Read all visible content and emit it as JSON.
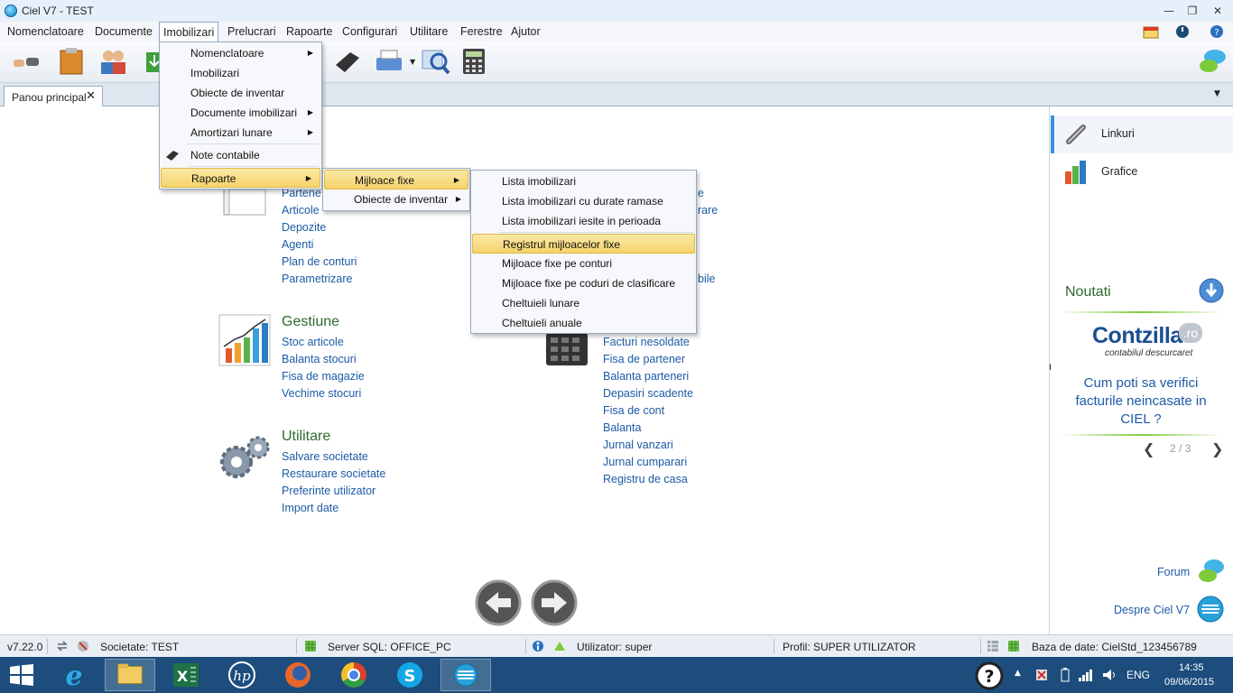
{
  "window": {
    "title": "Ciel V7 - TEST",
    "min": "—",
    "restore": "❐",
    "close": "✕"
  },
  "menubar": [
    "Nomenclatoare",
    "Documente",
    "Imobilizari",
    "Prelucrari",
    "Rapoarte",
    "Configurari",
    "Utilitare",
    "Ferestre",
    "Ajutor"
  ],
  "tab": {
    "label": "Panou principal",
    "close": "✕"
  },
  "main": {
    "col1": {
      "partial_links": [
        "Partene",
        "Articole",
        "Depozite",
        "Agenti",
        "Plan de conturi",
        "Parametrizare"
      ]
    },
    "gestiune": {
      "title": "Gestiune",
      "links": [
        "Stoc articole",
        "Balanta stocuri",
        "Fisa de magazie",
        "Vechime stocuri"
      ]
    },
    "utilitare": {
      "title": "Utilitare",
      "links": [
        "Salvare societate",
        "Restaurare societate",
        "Preferinte utilizator",
        "Import date"
      ]
    },
    "col2": {
      "partial_top": [
        "e",
        "rare"
      ],
      "partial_mid": "bile",
      "links": [
        "Facturi nesoldate",
        "Fisa de partener",
        "Balanta parteneri",
        "Depasiri scadente",
        "Fisa de cont",
        "Balanta",
        "Jurnal vanzari",
        "Jurnal cumparari",
        "Registru de casa"
      ]
    }
  },
  "menu_imobilizari": [
    {
      "label": "Nomenclatoare",
      "arrow": "▶"
    },
    {
      "label": "Imobilizari",
      "arrow": ""
    },
    {
      "label": "Obiecte de inventar",
      "arrow": ""
    },
    {
      "label": "Documente imobilizari",
      "arrow": "▶"
    },
    {
      "label": "Amortizari lunare",
      "arrow": "▶"
    },
    {
      "label": "Note contabile",
      "arrow": ""
    },
    {
      "label": "Rapoarte",
      "arrow": "▶"
    }
  ],
  "menu_rapoarte": [
    {
      "label": "Mijloace fixe",
      "arrow": "▶"
    },
    {
      "label": "Obiecte de inventar",
      "arrow": "▶"
    }
  ],
  "menu_mijloace": [
    "Lista imobilizari",
    "Lista imobilizari cu durate ramase",
    "Lista imobilizari iesite in perioada",
    "Registrul mijloacelor fixe",
    "Mijloace fixe pe conturi",
    "Mijloace fixe pe coduri de clasificare",
    "Cheltuieli lunare",
    "Cheltuieli anuale"
  ],
  "rightpane": {
    "linkuri": "Linkuri",
    "grafice": "Grafice",
    "noutati": "Noutati",
    "brand": "Contzilla",
    "brand_tld": ".ro",
    "brand_tag": "contabilul descurcaret",
    "promo": "Cum poti sa verifici facturile neincasate in CIEL ?",
    "pager": "2 / 3",
    "prev": "❮",
    "next": "❯",
    "forum": "Forum",
    "despre": "Despre Ciel V7"
  },
  "status": {
    "version": "v7.22.0",
    "societate": "Societate: TEST",
    "server": "Server SQL: OFFICE_PC",
    "utilizator": "Utilizator: super",
    "profil": "Profil: SUPER UTILIZATOR",
    "baza": "Baza de date: CielStd_123456789"
  },
  "taskbar": {
    "lang": "ENG",
    "time": "14:35",
    "date": "09/06/2015"
  },
  "colors": {
    "link": "#1c5aa6",
    "title_green": "#2e6b2e",
    "highlight": "#f5d36b",
    "taskbar": "#1c4d7c"
  }
}
